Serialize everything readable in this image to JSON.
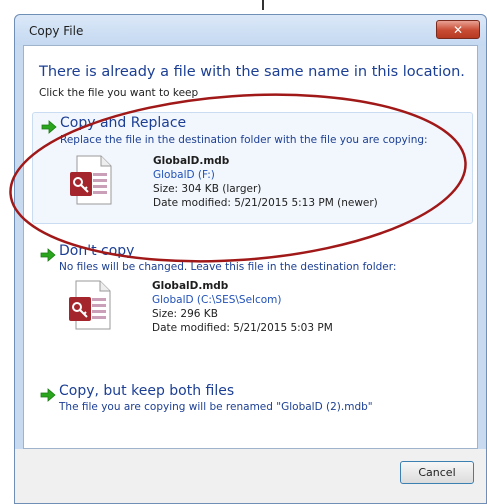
{
  "window": {
    "title": "Copy File",
    "close_label": "✕"
  },
  "header": {
    "heading": "There is already a file with the same name in this location.",
    "subheading": "Click the file you want to keep"
  },
  "options": [
    {
      "title": "Copy and Replace",
      "description": "Replace the file in the destination folder with the file you are copying:",
      "file": {
        "name": "GlobalD.mdb",
        "location": "GlobalD (F:)",
        "size": "Size: 304 KB (larger)",
        "date": "Date modified: 5/21/2015 5:13 PM (newer)"
      }
    },
    {
      "title": "Don't copy",
      "description": "No files will be changed. Leave this file in the destination folder:",
      "file": {
        "name": "GlobalD.mdb",
        "location": "GlobalD (C:\\SES\\Selcom)",
        "size": "Size: 296 KB",
        "date": "Date modified: 5/21/2015 5:03 PM"
      }
    },
    {
      "title": "Copy, but keep both files",
      "description": "The file you are copying will be renamed \"GlobalD (2).mdb\""
    }
  ],
  "footer": {
    "cancel_label": "Cancel"
  },
  "colors": {
    "accent": "#1c3f94",
    "arrow": "#2aa61e",
    "annotation": "#a01818"
  }
}
